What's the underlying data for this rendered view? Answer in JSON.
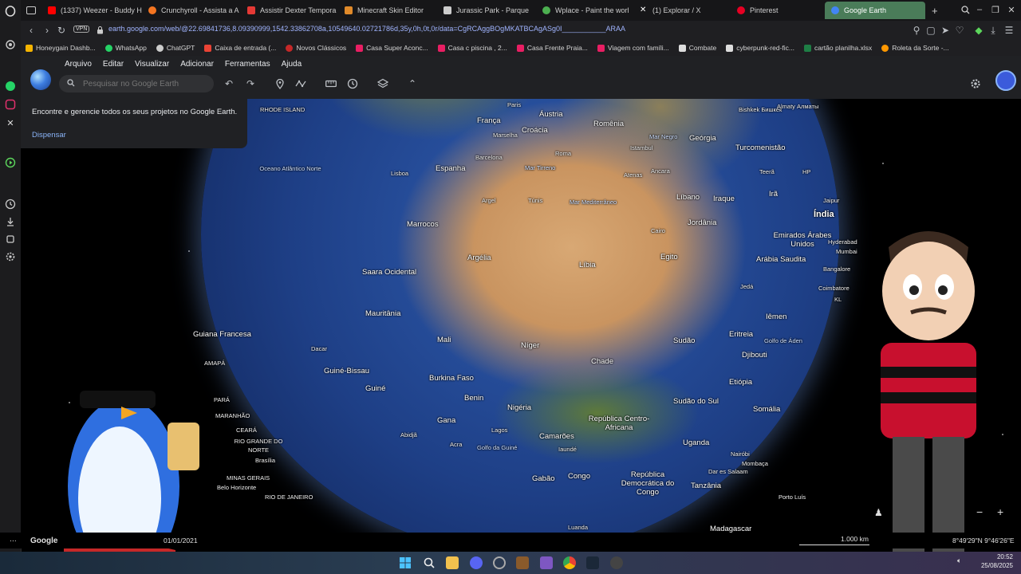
{
  "browser": {
    "tabs": [
      {
        "label": "(1337) Weezer - Buddy H",
        "color": "#ff0000"
      },
      {
        "label": "Crunchyroll - Assista a A",
        "color": "#f47521"
      },
      {
        "label": "Assistir Dexter Tempora",
        "color": "#e53935"
      },
      {
        "label": "Minecraft Skin Editor",
        "color": "#e08a2a"
      },
      {
        "label": "Jurassic Park - Parque",
        "color": "#cccccc"
      },
      {
        "label": "Wplace - Paint the worl",
        "color": "#4caf50"
      },
      {
        "label": "(1) Explorar / X",
        "color": "#ffffff"
      },
      {
        "label": "Pinterest",
        "color": "#e60023"
      },
      {
        "label": "Google Earth",
        "color": "#4285f4"
      }
    ],
    "new_tab_label": "+",
    "url": "earth.google.com/web/@22.69841736,8.09390999,1542.33862708a,10549640.02721786d,35y,0h,0t,0r/data=CgRCAggBOgMKATBCAgASg0I___________ARAA",
    "vpn_label": "VPN",
    "bookmarks": [
      {
        "label": "Honeygain Dashb...",
        "color": "#f5b400"
      },
      {
        "label": "WhatsApp",
        "color": "#25d366"
      },
      {
        "label": "ChatGPT",
        "color": "#cccccc"
      },
      {
        "label": "Caixa de entrada (...",
        "color": "#ea4335"
      },
      {
        "label": "Novos Clássicos",
        "color": "#c62828"
      },
      {
        "label": "Casa Super Aconc...",
        "color": "#e91e63"
      },
      {
        "label": "Casa c piscina , 2...",
        "color": "#e91e63"
      },
      {
        "label": "Casa Frente Praia...",
        "color": "#e91e63"
      },
      {
        "label": "Viagem com famíli...",
        "color": "#e91e63"
      },
      {
        "label": "Combate",
        "color": "#dddddd"
      },
      {
        "label": "cyberpunk-red-fic...",
        "color": "#dddddd"
      },
      {
        "label": "cartão planilha.xlsx",
        "color": "#1e7e45"
      },
      {
        "label": "Roleta da Sorte -...",
        "color": "#ff9800"
      }
    ]
  },
  "app": {
    "menu": [
      "Arquivo",
      "Editar",
      "Visualizar",
      "Adicionar",
      "Ferramentas",
      "Ajuda"
    ],
    "search_placeholder": "Pesquisar no Google Earth",
    "notice_text": "Encontre e gerencie todos os seus projetos no Google Earth.",
    "notice_dismiss": "Dispensar"
  },
  "map_labels": [
    {
      "text": "Paris",
      "cls": "city"
    },
    {
      "text": "Áustria",
      "cls": ""
    },
    {
      "text": "França",
      "cls": ""
    },
    {
      "text": "Croácia",
      "cls": ""
    },
    {
      "text": "Romênia",
      "cls": ""
    },
    {
      "text": "Marselha",
      "cls": "city"
    },
    {
      "text": "Mar Negro",
      "cls": "ocean"
    },
    {
      "text": "Geórgia",
      "cls": ""
    },
    {
      "text": "Turcomenistão",
      "cls": ""
    },
    {
      "text": "Istambul",
      "cls": "city"
    },
    {
      "text": "Barcelona",
      "cls": "city"
    },
    {
      "text": "Roma",
      "cls": "city"
    },
    {
      "text": "Espanha",
      "cls": ""
    },
    {
      "text": "Lisboa",
      "cls": "city"
    },
    {
      "text": "Mar Tirreno",
      "cls": "ocean"
    },
    {
      "text": "Atenas",
      "cls": "city"
    },
    {
      "text": "Ancara",
      "cls": "city"
    },
    {
      "text": "Teerã",
      "cls": "city"
    },
    {
      "text": "Irã",
      "cls": ""
    },
    {
      "text": "Iraque",
      "cls": ""
    },
    {
      "text": "Líbano",
      "cls": ""
    },
    {
      "text": "Argel",
      "cls": "city"
    },
    {
      "text": "Túnis",
      "cls": "city"
    },
    {
      "text": "Mar Mediterrâneo",
      "cls": "ocean"
    },
    {
      "text": "Marrocos",
      "cls": ""
    },
    {
      "text": "Cairo",
      "cls": "city"
    },
    {
      "text": "Jordânia",
      "cls": ""
    },
    {
      "text": "Índia",
      "cls": "big"
    },
    {
      "text": "Jaipur",
      "cls": "city"
    },
    {
      "text": "Emirados Árabes Unidos",
      "cls": ""
    },
    {
      "text": "Hyderabad",
      "cls": "city"
    },
    {
      "text": "Mumbai",
      "cls": "city"
    },
    {
      "text": "Bangalore",
      "cls": "city"
    },
    {
      "text": "Argélia",
      "cls": ""
    },
    {
      "text": "Líbia",
      "cls": ""
    },
    {
      "text": "Egito",
      "cls": ""
    },
    {
      "text": "Arábia Saudita",
      "cls": ""
    },
    {
      "text": "Saara Ocidental",
      "cls": ""
    },
    {
      "text": "Jedá",
      "cls": "city"
    },
    {
      "text": "Coimbatore",
      "cls": "city"
    },
    {
      "text": "Mauritânia",
      "cls": ""
    },
    {
      "text": "Iêmen",
      "cls": ""
    },
    {
      "text": "Guiana Francesa",
      "cls": ""
    },
    {
      "text": "Mali",
      "cls": ""
    },
    {
      "text": "Níger",
      "cls": ""
    },
    {
      "text": "Sudão",
      "cls": ""
    },
    {
      "text": "Eritreia",
      "cls": ""
    },
    {
      "text": "Golfo de Áden",
      "cls": "ocean"
    },
    {
      "text": "Dacar",
      "cls": "city"
    },
    {
      "text": "Djibouti",
      "cls": ""
    },
    {
      "text": "Chade",
      "cls": ""
    },
    {
      "text": "Guiné-Bissau",
      "cls": ""
    },
    {
      "text": "Burkina Faso",
      "cls": ""
    },
    {
      "text": "Etiópia",
      "cls": ""
    },
    {
      "text": "Guiné",
      "cls": ""
    },
    {
      "text": "Benin",
      "cls": ""
    },
    {
      "text": "Nigéria",
      "cls": ""
    },
    {
      "text": "Sudão do Sul",
      "cls": ""
    },
    {
      "text": "Somália",
      "cls": ""
    },
    {
      "text": "Gana",
      "cls": ""
    },
    {
      "text": "República Centro-Africana",
      "cls": ""
    },
    {
      "text": "Lagos",
      "cls": "city"
    },
    {
      "text": "Abidjã",
      "cls": "city"
    },
    {
      "text": "Camarões",
      "cls": ""
    },
    {
      "text": "Acra",
      "cls": "city"
    },
    {
      "text": "Golfo da Guiné",
      "cls": "ocean"
    },
    {
      "text": "Iaundé",
      "cls": "city"
    },
    {
      "text": "Uganda",
      "cls": ""
    },
    {
      "text": "Nairóbi",
      "cls": "city"
    },
    {
      "text": "Mombaça",
      "cls": "city"
    },
    {
      "text": "Dar es Salaam",
      "cls": "city"
    },
    {
      "text": "Gabão",
      "cls": ""
    },
    {
      "text": "Congo",
      "cls": ""
    },
    {
      "text": "República Democrática do Congo",
      "cls": ""
    },
    {
      "text": "Tanzânia",
      "cls": ""
    },
    {
      "text": "Porto Luís",
      "cls": "city"
    },
    {
      "text": "Luanda",
      "cls": "city"
    },
    {
      "text": "Madagascar",
      "cls": ""
    },
    {
      "text": "Oceano Atlântico Norte",
      "cls": "ocean"
    },
    {
      "text": "AMAPÁ",
      "cls": "city"
    },
    {
      "text": "PARÁ",
      "cls": "city"
    },
    {
      "text": "MARANHÃO",
      "cls": "city"
    },
    {
      "text": "CEARÁ",
      "cls": "city"
    },
    {
      "text": "RIO GRANDE DO NORTE",
      "cls": "city"
    },
    {
      "text": "Brasília",
      "cls": "city"
    },
    {
      "text": "MINAS GERAIS",
      "cls": "city"
    },
    {
      "text": "Belo Horizonte",
      "cls": "city"
    },
    {
      "text": "RIO DE JANEIRO",
      "cls": "city"
    },
    {
      "text": "RHODE ISLAND",
      "cls": "city"
    },
    {
      "text": "Bishkek Бишкек",
      "cls": "city"
    },
    {
      "text": "Almaty Алматы",
      "cls": "city"
    },
    {
      "text": "HP",
      "cls": "city"
    },
    {
      "text": "KL",
      "cls": "city"
    }
  ],
  "status": {
    "brand": "Google",
    "date": "01/01/2021",
    "scale": "1.000 km",
    "coords": "8°49'29\"N 9°46'26\"E",
    "time": "20:52",
    "date_os": "25/08/2025"
  },
  "colors": {
    "accent": "#8ab4f8",
    "active_tab": "#4a7c59",
    "panel": "#202124"
  }
}
